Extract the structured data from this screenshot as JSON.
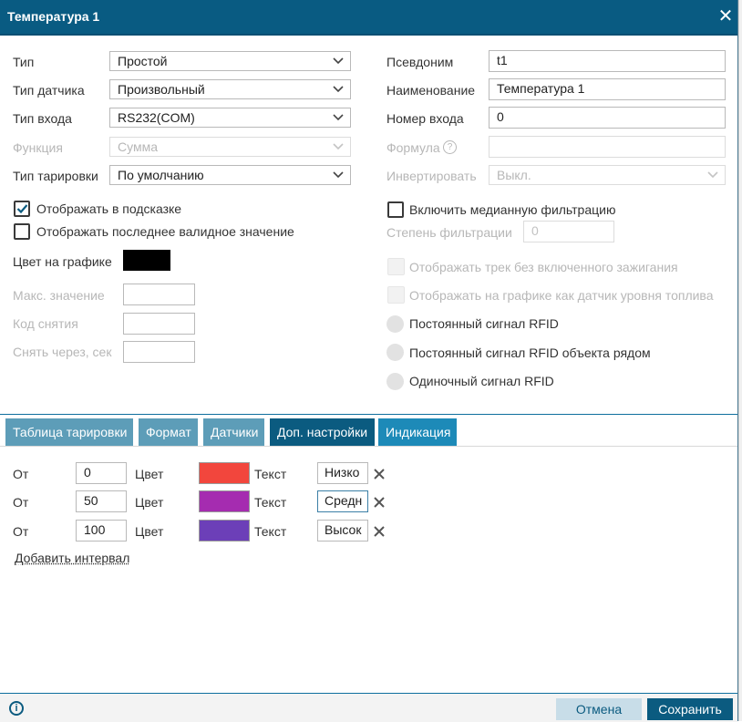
{
  "dialog": {
    "title": "Температура 1"
  },
  "left": {
    "type": {
      "label": "Тип",
      "value": "Простой"
    },
    "sensor_type": {
      "label": "Тип датчика",
      "value": "Произвольный"
    },
    "input_type": {
      "label": "Тип входа",
      "value": "RS232(COM)"
    },
    "function": {
      "label": "Функция",
      "value": "Сумма"
    },
    "calibration_type": {
      "label": "Тип тарировки",
      "value": "По умолчанию"
    },
    "show_in_tooltip": {
      "label": "Отображать в подсказке",
      "checked": true
    },
    "show_last_valid": {
      "label": "Отображать последнее валидное значение",
      "checked": false
    },
    "chart_color": {
      "label": "Цвет на графике",
      "color": "#000000"
    },
    "max_value": {
      "label": "Макс. значение",
      "value": ""
    },
    "removal_code": {
      "label": "Код снятия",
      "value": ""
    },
    "remove_after": {
      "label": "Снять через, сек",
      "value": ""
    }
  },
  "right": {
    "alias": {
      "label": "Псевдоним",
      "value": "t1"
    },
    "name": {
      "label": "Наименование",
      "value": "Температура 1"
    },
    "input_number": {
      "label": "Номер входа",
      "value": "0"
    },
    "formula": {
      "label": "Формула",
      "value": ""
    },
    "invert": {
      "label": "Инвертировать",
      "value": "Выкл."
    },
    "median_filter": {
      "label": "Включить медианную фильтрацию",
      "checked": false
    },
    "filter_degree": {
      "label": "Степень фильтрации",
      "value": "0"
    },
    "track_no_ignition": {
      "label": "Отображать трек без включенного зажигания"
    },
    "fuel_level_chart": {
      "label": "Отображать на графике как датчик уровня топлива"
    },
    "rfid_constant": {
      "label": "Постоянный сигнал RFID"
    },
    "rfid_constant_nearby": {
      "label": "Постоянный сигнал RFID объекта рядом"
    },
    "rfid_single": {
      "label": "Одиночный сигнал RFID"
    }
  },
  "tabs": [
    {
      "label": "Таблица тарировки"
    },
    {
      "label": "Формат"
    },
    {
      "label": "Датчики"
    },
    {
      "label": "Доп. настройки"
    },
    {
      "label": "Индикация"
    }
  ],
  "intervals": {
    "labels": {
      "from": "От",
      "color": "Цвет",
      "text": "Текст"
    },
    "rows": [
      {
        "from": "0",
        "color": "#f2463d",
        "text": "Низко"
      },
      {
        "from": "50",
        "color": "#a52cb0",
        "text": "Средн"
      },
      {
        "from": "100",
        "color": "#6c3fb8",
        "text": "Высок"
      }
    ],
    "add_label": "Добавить интервал"
  },
  "footer": {
    "cancel": "Отмена",
    "save": "Сохранить"
  }
}
